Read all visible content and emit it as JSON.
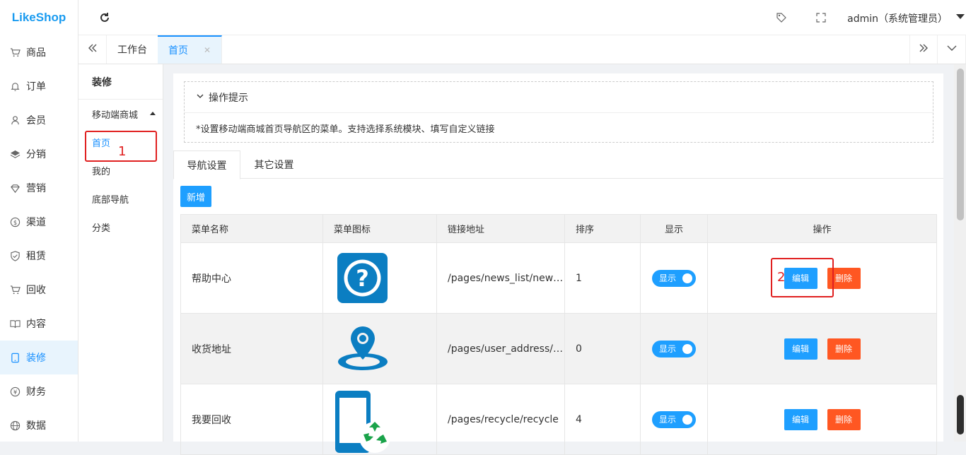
{
  "app": {
    "logo": "LikeShop",
    "accent": "#1e9fff"
  },
  "sidebar": {
    "items": [
      {
        "label": "商品",
        "icon": "cart-icon"
      },
      {
        "label": "订单",
        "icon": "bell-icon"
      },
      {
        "label": "会员",
        "icon": "user-icon"
      },
      {
        "label": "分销",
        "icon": "layers-icon"
      },
      {
        "label": "营销",
        "icon": "diamond-icon"
      },
      {
        "label": "渠道",
        "icon": "dollar-icon"
      },
      {
        "label": "租赁",
        "icon": "shield-icon"
      },
      {
        "label": "回收",
        "icon": "cart-icon"
      },
      {
        "label": "内容",
        "icon": "book-icon"
      },
      {
        "label": "装修",
        "icon": "tablet-icon",
        "active": true
      },
      {
        "label": "财务",
        "icon": "yen-icon"
      },
      {
        "label": "数据",
        "icon": "globe-icon"
      }
    ]
  },
  "header": {
    "user": "admin（系统管理员）"
  },
  "tabs": [
    {
      "label": "工作台"
    },
    {
      "label": "首页",
      "active": true
    }
  ],
  "subnav": {
    "title": "装修",
    "group": "移动端商城",
    "items": [
      "首页",
      "我的",
      "底部导航",
      "分类"
    ]
  },
  "annotations": {
    "n1": "1",
    "n2": "2"
  },
  "tips": {
    "title": "操作提示",
    "body": "*设置移动端商城首页导航区的菜单。支持选择系统模块、填写自定义链接"
  },
  "page_tabs": [
    "导航设置",
    "其它设置"
  ],
  "add_label": "新增",
  "table": {
    "headers": [
      "菜单名称",
      "菜单图标",
      "链接地址",
      "排序",
      "显示",
      "操作"
    ],
    "rows": [
      {
        "name": "帮助中心",
        "icon": "help-icon",
        "link": "/pages/news_list/news_list",
        "order": "1",
        "show": "显示"
      },
      {
        "name": "收货地址",
        "icon": "location-icon",
        "link": "/pages/user_address/user_address",
        "order": "0",
        "show": "显示"
      },
      {
        "name": "我要回收",
        "icon": "recycle-phone-icon",
        "link": "/pages/recycle/recycle",
        "order": "4",
        "show": "显示"
      }
    ],
    "edit_label": "编辑",
    "delete_label": "删除"
  }
}
